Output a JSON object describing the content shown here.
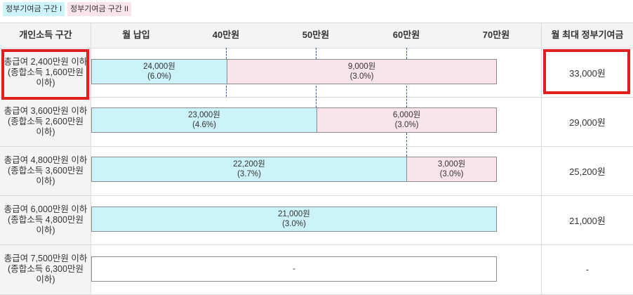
{
  "legend": {
    "zone1_label": "정부기여금 구간 I",
    "zone2_label": "정부기여금 구간 II"
  },
  "header": {
    "income_col": "개인소득 구간",
    "monthly_payment": "월 납입",
    "ticks": [
      "40만원",
      "50만원",
      "60만원",
      "70만원"
    ],
    "max_col": "월 최대 정부기여금"
  },
  "rows": [
    {
      "line1": "총급여 2,400만원 이하",
      "line2": "(종합소득 1,600만원",
      "line3": "이하)",
      "zone1_amount": "24,000원",
      "zone1_rate": "(6.0%)",
      "zone2_amount": "9,000원",
      "zone2_rate": "(3.0%)",
      "max": "33,000원"
    },
    {
      "line1": "총급여 3,600만원 이하",
      "line2": "(종합소득 2,600만원",
      "line3": "이하)",
      "zone1_amount": "23,000원",
      "zone1_rate": "(4.6%)",
      "zone2_amount": "6,000원",
      "zone2_rate": "(3.0%)",
      "max": "29,000원"
    },
    {
      "line1": "총급여 4,800만원 이하",
      "line2": "(종합소득 3,600만원",
      "line3": "이하)",
      "zone1_amount": "22,200원",
      "zone1_rate": "(3.7%)",
      "zone2_amount": "3,000원",
      "zone2_rate": "(3.0%)",
      "max": "25,200원"
    },
    {
      "line1": "총급여 6,000만원 이하",
      "line2": "(종합소득 4,800만원",
      "line3": "이하)",
      "zone1_amount": "21,000원",
      "zone1_rate": "(3.0%)",
      "max": "21,000원"
    },
    {
      "line1": "총급여 7,500만원 이하",
      "line2": "(종합소득 6,300만원",
      "line3": "이하)",
      "empty_value": "-",
      "max": "-"
    }
  ],
  "colors": {
    "zone1": "#ccf2fa",
    "zone2": "#fae4ec",
    "highlight": "#e02020"
  }
}
